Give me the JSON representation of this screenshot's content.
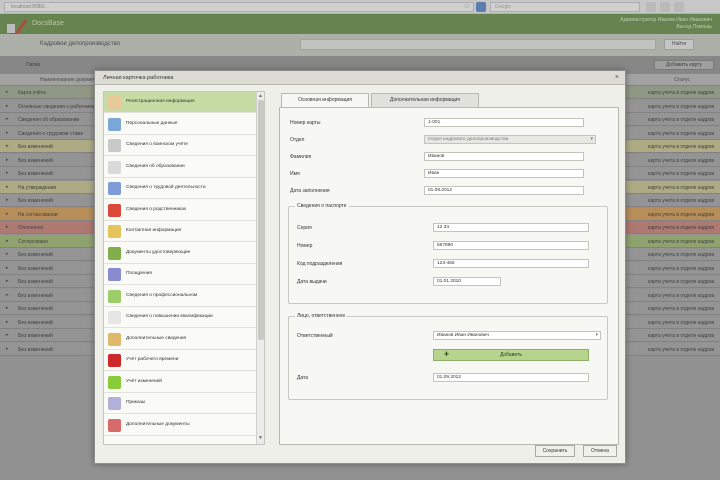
{
  "browser": {
    "url": "localhost:8080/...",
    "search_placeholder": "Google"
  },
  "header": {
    "app_name": "DocsBase",
    "section_title": "Кадровое делопроизводство",
    "user_line1": "Администратор Иванов Иван Иванович",
    "user_line2": "Выход  Помощь",
    "search_button": "Найти"
  },
  "list": {
    "toolbar_label": "Папки",
    "add_button": "Добавить карту",
    "head_left": "Наименование документа",
    "head_right": "Статус",
    "rows": [
      {
        "label": "Карта учёта",
        "right": "карта учета в отделе кадров",
        "color": "#9aa98c"
      },
      {
        "label": "Основные сведения о работнике",
        "right": "карта учета в отделе кадров",
        "color": "#a3a3a3"
      },
      {
        "label": "Сведения об образовании",
        "right": "карта учета в отделе кадров",
        "color": "#a3a3a3"
      },
      {
        "label": "Сведения о трудовом стаже",
        "right": "карта учета в отделе кадров",
        "color": "#a3a3a3"
      },
      {
        "label": "Без изменений",
        "right": "карта учета в отделе кадров",
        "color": "#c9c58a"
      },
      {
        "label": "Без изменений",
        "right": "карта учета в отделе кадров",
        "color": "#a3a3a3"
      },
      {
        "label": "Без изменений",
        "right": "карта учета в отделе кадров",
        "color": "#a3a3a3"
      },
      {
        "label": "На утверждении",
        "right": "карта учета в отделе кадров",
        "color": "#c9c58a"
      },
      {
        "label": "Без изменений",
        "right": "карта учета в отделе кадров",
        "color": "#a3a3a3"
      },
      {
        "label": "На согласовании",
        "right": "карта учета в отделе кадров",
        "color": "#d99a4a"
      },
      {
        "label": "Отклонено",
        "right": "карта учета в отделе кадров",
        "color": "#c97a6e"
      },
      {
        "label": "Согласовано",
        "right": "карта учета в отделе кадров",
        "color": "#9dbb6a"
      },
      {
        "label": "Без изменений",
        "right": "карта учета в отделе кадров",
        "color": "#a3a3a3"
      },
      {
        "label": "Без изменений",
        "right": "карта учета в отделе кадров",
        "color": "#a3a3a3"
      },
      {
        "label": "Без изменений",
        "right": "карта учета в отделе кадров",
        "color": "#a3a3a3"
      },
      {
        "label": "Без изменений",
        "right": "карта учета в отделе кадров",
        "color": "#a3a3a3"
      },
      {
        "label": "Без изменений",
        "right": "карта учета в отделе кадров",
        "color": "#a3a3a3"
      },
      {
        "label": "Без изменений",
        "right": "карта учета в отделе кадров",
        "color": "#a3a3a3"
      },
      {
        "label": "Без изменений",
        "right": "карта учета в отделе кадров",
        "color": "#a3a3a3"
      },
      {
        "label": "Без изменений",
        "right": "карта учета в отделе кадров",
        "color": "#a3a3a3"
      }
    ]
  },
  "modal": {
    "title": "Личная карточка работника",
    "nav": [
      {
        "label": "Регистрационная информация",
        "icon_color": "#e8c99a",
        "active": true
      },
      {
        "label": "Персональные данные",
        "icon_color": "#7aa6d8",
        "active": false
      },
      {
        "label": "Сведения о воинском учёте",
        "icon_color": "#c9c9c9",
        "active": false
      },
      {
        "label": "Сведения об образовании",
        "icon_color": "#d9d9d9",
        "active": false
      },
      {
        "label": "Сведения о трудовой деятельности",
        "icon_color": "#7d9cd8",
        "active": false
      },
      {
        "label": "Сведения о родственниках",
        "icon_color": "#d94a3a",
        "active": false
      },
      {
        "label": "Контактная информация",
        "icon_color": "#e6c35a",
        "active": false
      },
      {
        "label": "Документы удостоверяющие",
        "icon_color": "#7fae4a",
        "active": false
      },
      {
        "label": "Поощрения",
        "icon_color": "#8a8ad0",
        "active": false
      },
      {
        "label": "Сведения о профессиональном",
        "icon_color": "#9ccf6a",
        "active": false
      },
      {
        "label": "Сведения о повышении квалификации",
        "icon_color": "#e6e6e6",
        "active": false
      },
      {
        "label": "Дополнительные сведения",
        "icon_color": "#e0b86a",
        "active": false
      },
      {
        "label": "Учёт рабочего времени",
        "icon_color": "#cc2a2a",
        "active": false
      },
      {
        "label": "Учёт изменений",
        "icon_color": "#8acb3a",
        "active": false
      },
      {
        "label": "Приказы",
        "icon_color": "#b0b0d8",
        "active": false
      },
      {
        "label": "Дополнительные документы",
        "icon_color": "#d86a6a",
        "active": false
      }
    ],
    "tabs": [
      {
        "label": "Основная информация"
      },
      {
        "label": "Дополнительная информация"
      }
    ],
    "form": {
      "card_number_label": "Номер карты",
      "card_number_value": "1-001",
      "department_label": "Отдел",
      "department_value": "Отдел кадрового делопроизводства",
      "last_name_label": "Фамилия",
      "last_name_value": "Иванов",
      "first_name_label": "Имя",
      "first_name_value": "Иван",
      "date_label": "Дата заполнения",
      "date_value": "01.09.2012"
    },
    "fieldset1": {
      "legend": "Сведения о паспорте",
      "series_label": "Серия",
      "series_value": "12 34",
      "number_label": "Номер",
      "number_value": "567890",
      "code_label": "Код подразделения",
      "code_value": "123-456",
      "issue_label": "Дата выдачи",
      "issue_value": "01.01.2010"
    },
    "fieldset2": {
      "legend": "Лицо, ответственное",
      "person_label": "Ответственный",
      "person_value": "Иванов Иван Иванович",
      "add_button": "Добавить",
      "date_label": "Дата",
      "date_value": "01.09.2012"
    },
    "save_button": "Сохранить",
    "cancel_button": "Отмена"
  }
}
